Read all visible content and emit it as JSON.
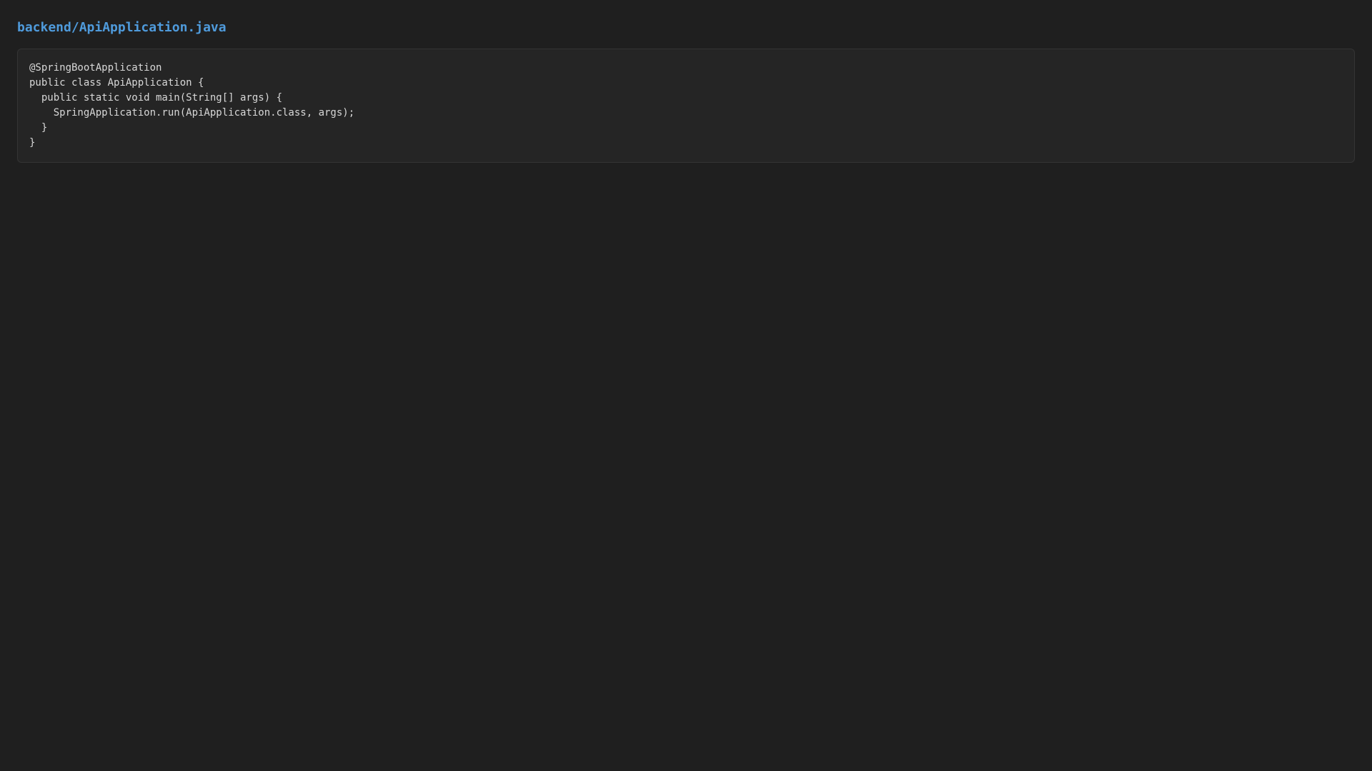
{
  "file": {
    "title": "backend/ApiApplication.java"
  },
  "code": {
    "lines": [
      "@SpringBootApplication",
      "public class ApiApplication {",
      "  public static void main(String[] args) {",
      "    SpringApplication.run(ApiApplication.class, args);",
      "  }",
      "}"
    ]
  },
  "colors": {
    "background": "#1f1f1f",
    "code_background": "#252525",
    "title": "#4f9bdc",
    "text": "#d8d8d8"
  }
}
